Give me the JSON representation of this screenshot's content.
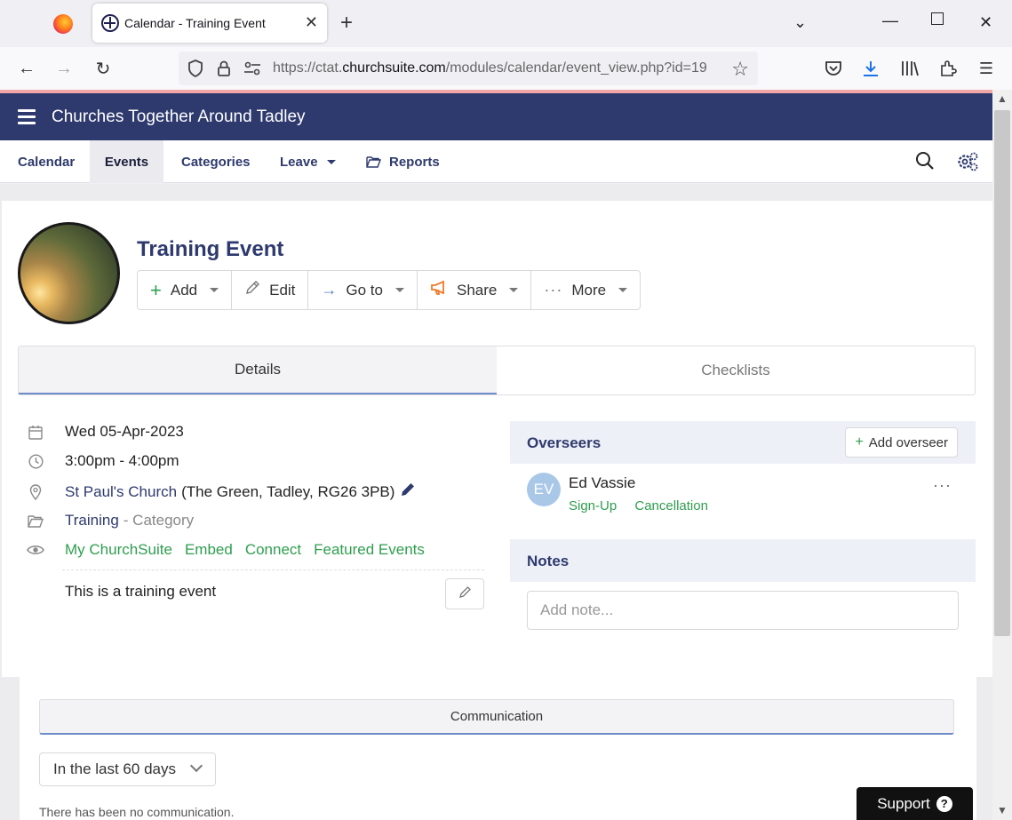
{
  "browser": {
    "tab_title": "Calendar - Training Event",
    "url_host_prefix": "https://ctat.",
    "url_host_main": "churchsuite.com",
    "url_path": "/modules/calendar/event_view.php?id=19"
  },
  "app": {
    "title": "Churches Together Around Tadley",
    "nav": {
      "calendar": "Calendar",
      "events": "Events",
      "categories": "Categories",
      "leave": "Leave",
      "reports": "Reports"
    }
  },
  "event": {
    "title": "Training Event",
    "actions": {
      "add": "Add",
      "edit": "Edit",
      "goto": "Go to",
      "share": "Share",
      "more": "More"
    },
    "tabs": {
      "details": "Details",
      "checklists": "Checklists"
    },
    "date": "Wed 05-Apr-2023",
    "time": "3:00pm - 4:00pm",
    "location_name": "St Paul's Church",
    "location_address": "(The Green, Tadley, RG26 3PB)",
    "category_name": "Training",
    "category_suffix": "- Category",
    "visibility": [
      "My ChurchSuite",
      "Embed",
      "Connect",
      "Featured Events"
    ],
    "description": "This is a training event"
  },
  "overseers": {
    "title": "Overseers",
    "add_label": "Add overseer",
    "items": [
      {
        "initials": "EV",
        "name": "Ed Vassie",
        "links": [
          "Sign-Up",
          "Cancellation"
        ]
      }
    ]
  },
  "notes": {
    "title": "Notes",
    "placeholder": "Add note..."
  },
  "communication": {
    "title": "Communication",
    "period": "In the last 60 days",
    "empty": "There has been no communication."
  },
  "support_label": "Support",
  "colors": {
    "brand_navy": "#2e3a6e",
    "accent_green": "#2f9e4f",
    "tab_underline": "#6e8cc8"
  }
}
